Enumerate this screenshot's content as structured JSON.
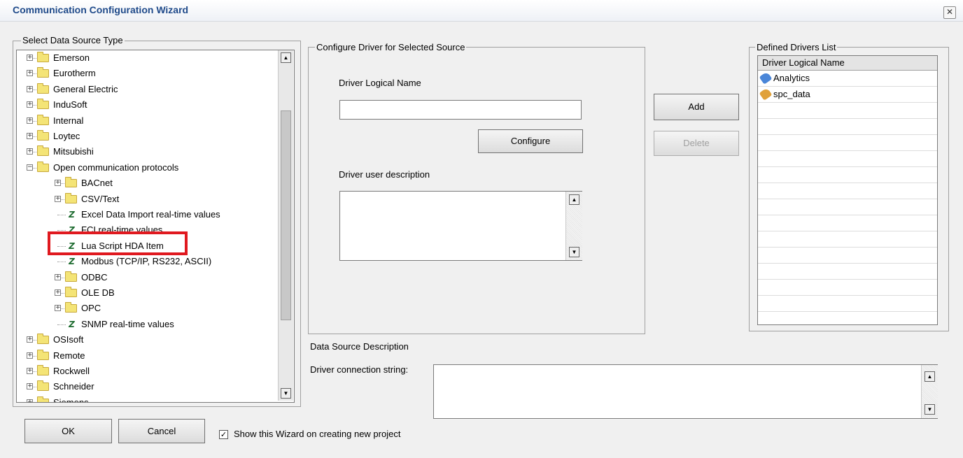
{
  "window": {
    "title": "Communication Configuration Wizard",
    "close_glyph": "✕"
  },
  "source_group": {
    "label": "Select Data Source Type",
    "tree": [
      {
        "label": "Emerson",
        "kind": "folder",
        "level": 0,
        "expander": "+"
      },
      {
        "label": "Eurotherm",
        "kind": "folder",
        "level": 0,
        "expander": "+"
      },
      {
        "label": "General Electric",
        "kind": "folder",
        "level": 0,
        "expander": "+"
      },
      {
        "label": "InduSoft",
        "kind": "folder",
        "level": 0,
        "expander": "+"
      },
      {
        "label": "Internal",
        "kind": "folder",
        "level": 0,
        "expander": "+"
      },
      {
        "label": "Loytec",
        "kind": "folder",
        "level": 0,
        "expander": "+"
      },
      {
        "label": "Mitsubishi",
        "kind": "folder",
        "level": 0,
        "expander": "+"
      },
      {
        "label": "Open communication protocols",
        "kind": "folder",
        "level": 0,
        "expander": "−"
      },
      {
        "label": "BACnet",
        "kind": "folder",
        "level": 1,
        "expander": "+"
      },
      {
        "label": "CSV/Text",
        "kind": "folder",
        "level": 1,
        "expander": "+"
      },
      {
        "label": "Excel Data Import real-time values",
        "kind": "driver",
        "level": 1,
        "expander": ""
      },
      {
        "label": "FCI real-time values",
        "kind": "driver",
        "level": 1,
        "expander": ""
      },
      {
        "label": "Lua Script  HDA Item",
        "kind": "driver",
        "level": 1,
        "expander": "",
        "highlighted": true
      },
      {
        "label": "Modbus (TCP/IP, RS232, ASCII)",
        "kind": "driver",
        "level": 1,
        "expander": ""
      },
      {
        "label": "ODBC",
        "kind": "folder",
        "level": 1,
        "expander": "+"
      },
      {
        "label": "OLE DB",
        "kind": "folder",
        "level": 1,
        "expander": "+"
      },
      {
        "label": "OPC",
        "kind": "folder",
        "level": 1,
        "expander": "+"
      },
      {
        "label": "SNMP real-time values",
        "kind": "driver",
        "level": 1,
        "expander": ""
      },
      {
        "label": "OSIsoft",
        "kind": "folder",
        "level": 0,
        "expander": "+"
      },
      {
        "label": "Remote",
        "kind": "folder",
        "level": 0,
        "expander": "+"
      },
      {
        "label": "Rockwell",
        "kind": "folder",
        "level": 0,
        "expander": "+"
      },
      {
        "label": "Schneider",
        "kind": "folder",
        "level": 0,
        "expander": "+"
      },
      {
        "label": "Siemens",
        "kind": "folder",
        "level": 0,
        "expander": "+"
      }
    ],
    "driver_icon_glyph": "Z",
    "scroll_up_glyph": "▲",
    "scroll_down_glyph": "▼"
  },
  "configure_group": {
    "label": "Configure Driver for Selected Source",
    "logical_name_label": "Driver Logical Name",
    "logical_name_value": "",
    "configure_button": "Configure",
    "description_label": "Driver user description",
    "description_value": ""
  },
  "actions": {
    "add_button": "Add",
    "delete_button": "Delete"
  },
  "drivers_group": {
    "label": "Defined Drivers List",
    "column_header": "Driver Logical Name",
    "rows": [
      {
        "label": "Analytics",
        "icon": "analytics-tag-icon",
        "color": "#4a86d8"
      },
      {
        "label": "spc_data",
        "icon": "database-tag-icon",
        "color": "#e0a13a"
      }
    ]
  },
  "data_source": {
    "description_label": "Data Source Description",
    "connection_label": "Driver connection string:",
    "connection_value": ""
  },
  "footer": {
    "ok_button": "OK",
    "cancel_button": "Cancel",
    "show_wizard_label": "Show this Wizard on creating new project",
    "show_wizard_checked": true,
    "check_glyph": "✓"
  },
  "colors": {
    "title_text": "#1f4a8a",
    "highlight": "#e0191f",
    "folder": "#f4e476"
  }
}
